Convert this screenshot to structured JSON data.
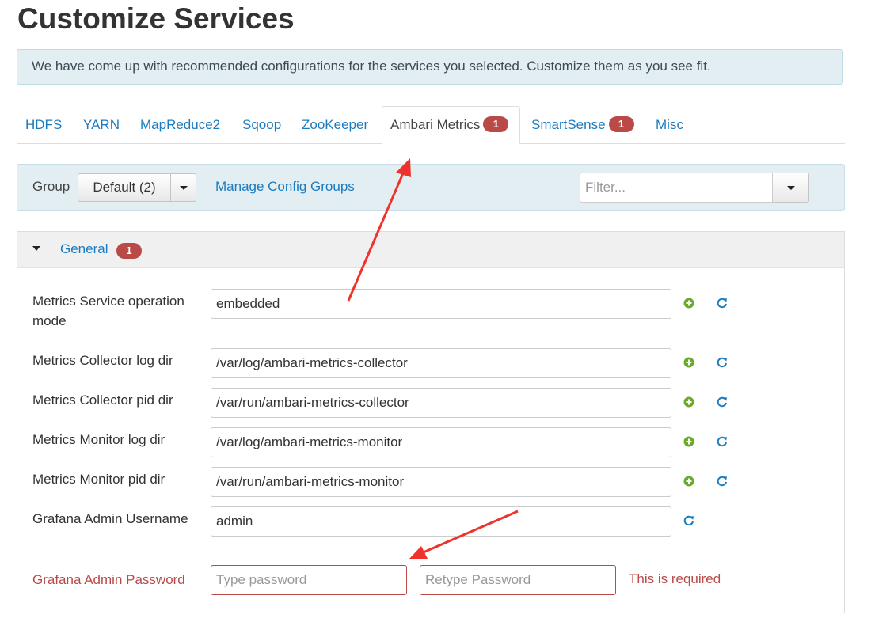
{
  "title": "Customize Services",
  "alert": "We have come up with recommended configurations for the services you selected. Customize them as you see fit.",
  "tabs": [
    {
      "label": "HDFS",
      "badge": ""
    },
    {
      "label": "YARN",
      "badge": ""
    },
    {
      "label": "MapReduce2",
      "badge": ""
    },
    {
      "label": "Sqoop",
      "badge": ""
    },
    {
      "label": "ZooKeeper",
      "badge": ""
    },
    {
      "label": "Ambari Metrics",
      "badge": "1",
      "active": true
    },
    {
      "label": "SmartSense",
      "badge": "1"
    },
    {
      "label": "Misc",
      "badge": ""
    }
  ],
  "toolbar": {
    "group_label": "Group",
    "group_value": "Default (2)",
    "manage_link": "Manage Config Groups",
    "filter_placeholder": "Filter..."
  },
  "section": {
    "title": "General",
    "badge": "1"
  },
  "fields": [
    {
      "label": "Metrics Service operation mode",
      "value": "embedded"
    },
    {
      "label": "Metrics Collector log dir",
      "value": "/var/log/ambari-metrics-collector"
    },
    {
      "label": "Metrics Collector pid dir",
      "value": "/var/run/ambari-metrics-collector"
    },
    {
      "label": "Metrics Monitor log dir",
      "value": "/var/log/ambari-metrics-monitor"
    },
    {
      "label": "Metrics Monitor pid dir",
      "value": "/var/run/ambari-metrics-monitor"
    },
    {
      "label": "Grafana Admin Username",
      "value": "admin"
    }
  ],
  "password": {
    "label": "Grafana Admin Password",
    "placeholder": "Type password",
    "retype_placeholder": "Retype Password",
    "error": "This is required"
  },
  "colors": {
    "link": "#1b7bbf",
    "badge": "#b94a48",
    "error": "#b94a48",
    "add_icon": "#6aaa2a",
    "annotation_arrow": "#f0322d"
  },
  "icons": {
    "add": "plus-circle-icon",
    "undo": "undo-icon",
    "caret": "caret-down-icon"
  }
}
